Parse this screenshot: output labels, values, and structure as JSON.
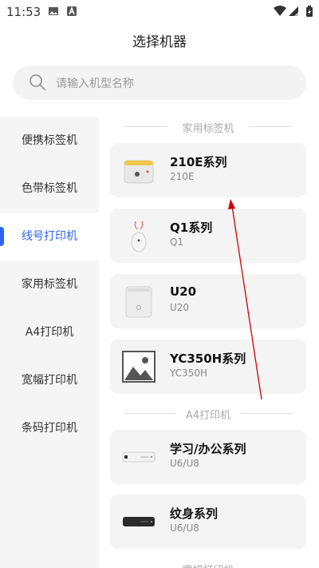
{
  "status": {
    "time": "11:53"
  },
  "title": "选择机器",
  "search": {
    "placeholder": "请输入机型名称"
  },
  "sidebar": {
    "items": [
      {
        "label": "便携标签机"
      },
      {
        "label": "色带标签机"
      },
      {
        "label": "线号打印机",
        "active": true
      },
      {
        "label": "家用标签机"
      },
      {
        "label": "A4打印机"
      },
      {
        "label": "宽幅打印机"
      },
      {
        "label": "条码打印机"
      }
    ]
  },
  "sections": [
    {
      "header": "家用标签机",
      "devices": [
        {
          "name": "210E系列",
          "model": "210E",
          "icon": "printer-210e-image"
        },
        {
          "name": "Q1系列",
          "model": "Q1",
          "icon": "printer-q1-image"
        },
        {
          "name": "U20",
          "model": "U20",
          "icon": "printer-u20-image"
        },
        {
          "name": "YC350H系列",
          "model": "YC350H",
          "icon": "placeholder-image-icon"
        }
      ]
    },
    {
      "header": "A4打印机",
      "devices": [
        {
          "name": "学习/办公系列",
          "model": "U6/U8",
          "icon": "printer-study-image"
        },
        {
          "name": "纹身系列",
          "model": "U6/U8",
          "icon": "printer-tattoo-image"
        }
      ]
    },
    {
      "header": "宽幅打印机",
      "devices": []
    }
  ],
  "colors": {
    "accent": "#2f63f5",
    "annotation_arrow": "#cc0000"
  }
}
